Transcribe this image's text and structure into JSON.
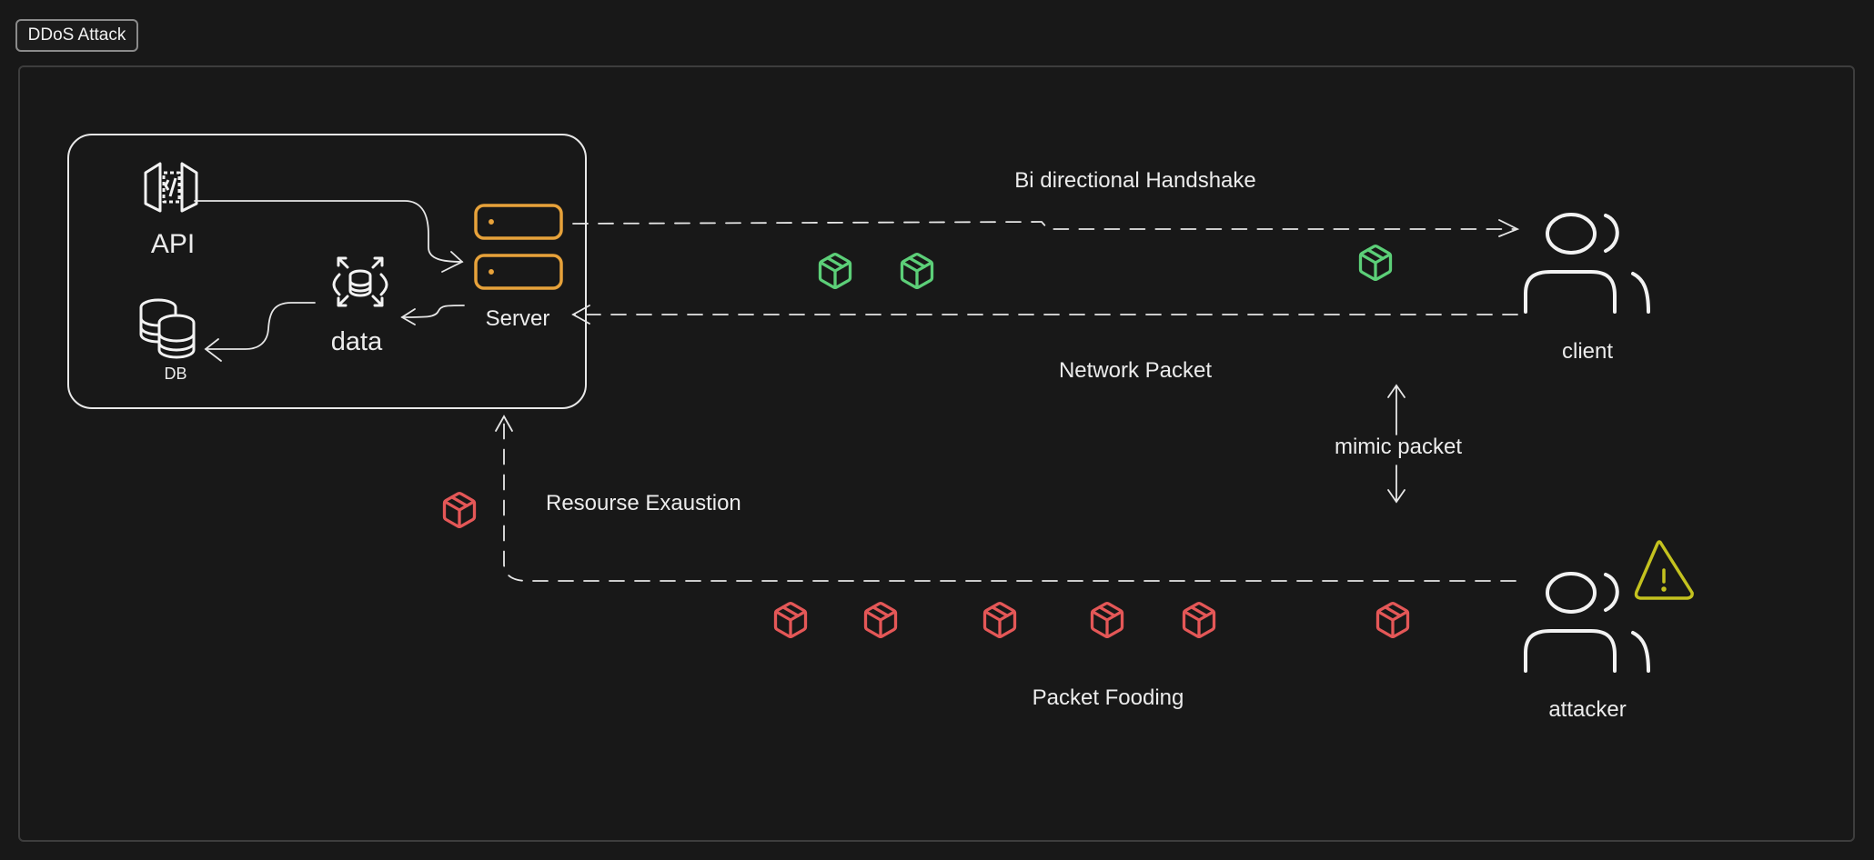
{
  "frame_title": "DDoS Attack",
  "labels": {
    "api": "API",
    "db": "DB",
    "data": "data",
    "server": "Server",
    "handshake": "Bi directional Handshake",
    "network_packet": "Network Packet",
    "client": "client",
    "mimic_packet": "mimic packet",
    "attacker": "attacker",
    "resource_exhaustion": "Resourse Exaustion",
    "packet_flooding": "Packet Fooding"
  },
  "icons": {
    "api": "api-gateway-icon",
    "db": "database-icon",
    "data": "data-distribution-icon",
    "server": "server-icon",
    "user": "user-group-icon",
    "warning": "warning-triangle-icon",
    "packet": "package-icon"
  },
  "packets": {
    "legit_count": 3,
    "malicious_count": 7
  },
  "colors": {
    "background": "#181818",
    "line": "#e6e6e6",
    "server": "#e7a23a",
    "legit_packet": "#5ccf78",
    "malicious_packet": "#e45757",
    "warning": "#c4c21f"
  }
}
